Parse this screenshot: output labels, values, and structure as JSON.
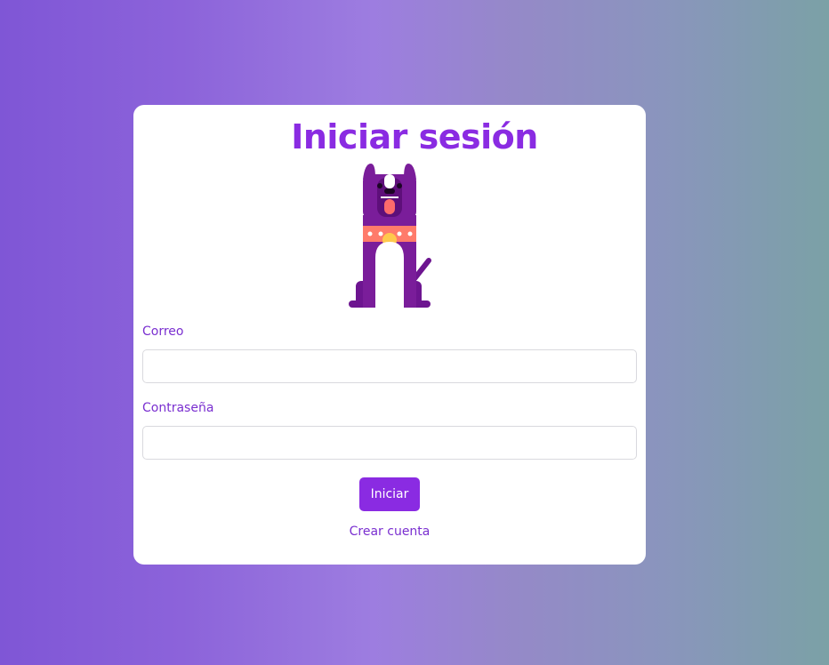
{
  "login": {
    "title": "Iniciar sesión",
    "email_label": "Correo",
    "email_value": "",
    "password_label": "Contraseña",
    "password_value": "",
    "submit_label": "Iniciar",
    "create_account_label": "Crear cuenta"
  },
  "mascot": {
    "icon": "dog-mascot-icon"
  },
  "colors": {
    "accent": "#8a2be2",
    "label": "#7a2fd0",
    "card": "#ffffff",
    "background_start": "#7f56d6",
    "background_end": "#7ba1a6",
    "dog_body": "#7a1d9a",
    "dog_collar": "#ff7b6b"
  }
}
